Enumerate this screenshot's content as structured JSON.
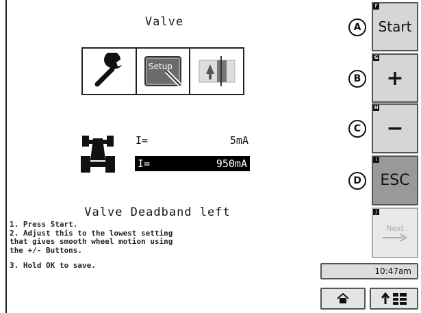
{
  "screen": {
    "title": "Valve"
  },
  "tool_tabs": {
    "setup_label": "Setup"
  },
  "current": {
    "row1_label": "I=",
    "row1_value": "5mA",
    "row2_label": "I=",
    "row2_value": "950mA"
  },
  "instructions": {
    "title": "Valve Deadband left",
    "lines": [
      "1. Press Start.",
      "2. Adjust this to the lowest setting",
      "that gives smooth wheel motion using",
      "the +/- Buttons.",
      "3. Hold OK to save."
    ]
  },
  "softkeys": [
    {
      "key": "F",
      "circle": "A",
      "label": "Start"
    },
    {
      "key": "G",
      "circle": "B",
      "label": "+"
    },
    {
      "key": "H",
      "circle": "C",
      "label": "−"
    },
    {
      "key": "I",
      "circle": "D",
      "label": "ESC"
    },
    {
      "key": "J",
      "label": "Next"
    }
  ],
  "status": {
    "time": "10:47am"
  },
  "icons": {
    "wrench": "wrench-icon",
    "setup": "setup-icon",
    "calibration": "calibration-icon",
    "tractor": "tractor-icon",
    "home": "home-icon",
    "menu": "menu-icon",
    "next_arrow": "arrow-right-icon"
  },
  "colors": {
    "softkey_bg": "#d6d6d6",
    "esc_bg": "#999999",
    "highlight_bg": "#000000"
  }
}
